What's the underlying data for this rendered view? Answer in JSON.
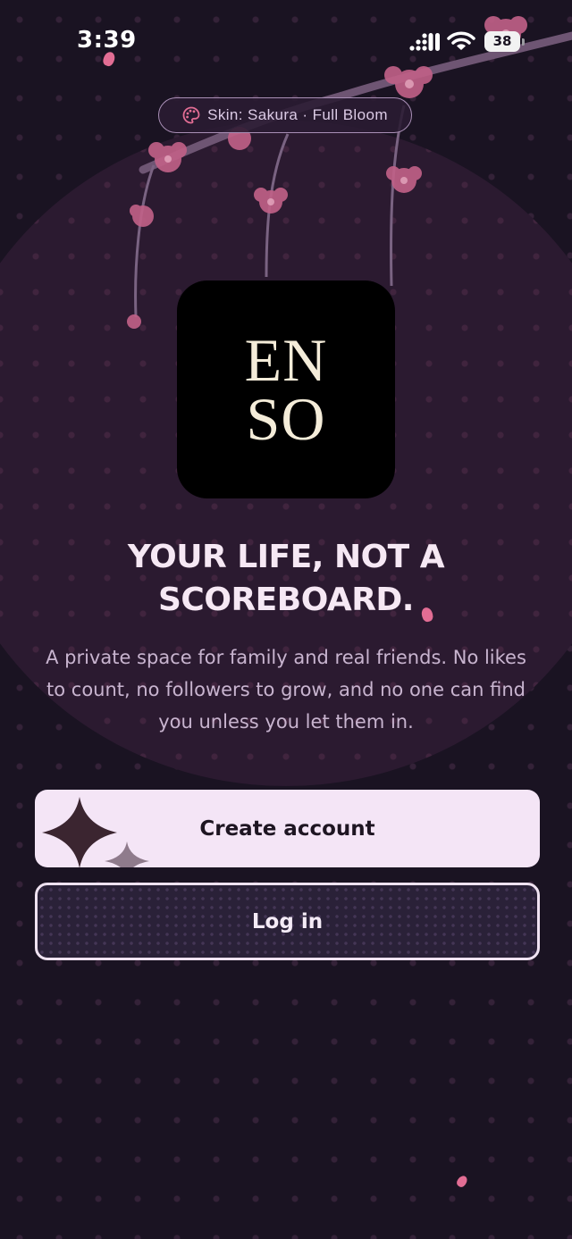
{
  "status_bar": {
    "time": "3:39",
    "battery": "38"
  },
  "theme": {
    "skin_label": "Skin: Sakura · Full Bloom",
    "accent_color": "#e26d94",
    "background_color": "#1a1322"
  },
  "logo": {
    "line1": "EN",
    "line2": "SO"
  },
  "headline": "YOUR LIFE, NOT A SCOREBOARD.",
  "tagline": "A private space for family and real friends. No likes to count, no followers to grow, and no one can find you unless you let them in.",
  "buttons": {
    "create_account": "Create account",
    "log_in": "Log in"
  },
  "icons": {
    "skin": "palette-icon",
    "signal": "cellular-signal-icon",
    "wifi": "wifi-icon",
    "battery": "battery-icon",
    "sparkle": "sparkle-icon"
  }
}
